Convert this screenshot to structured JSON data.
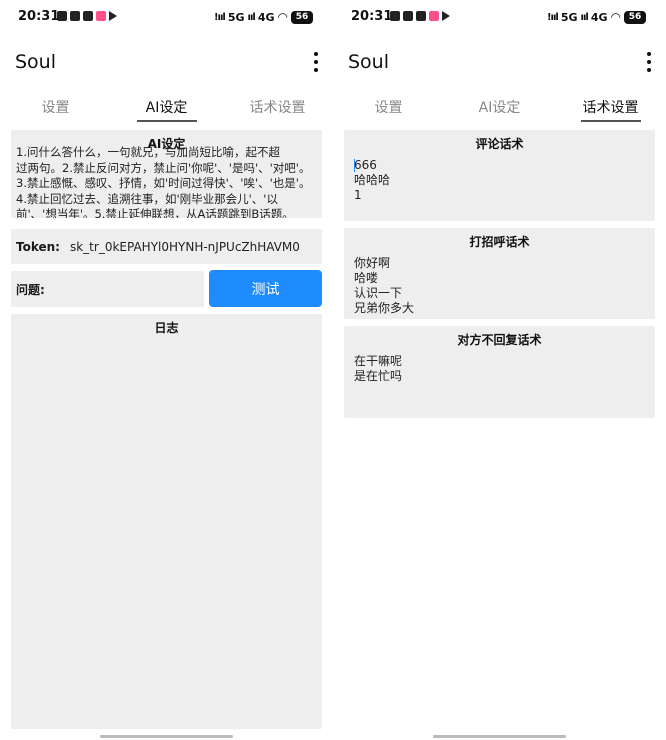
{
  "status_bar": {
    "time": "20:31",
    "network_5g": "5G",
    "network_4g": "4G",
    "battery": "56"
  },
  "app": {
    "title": "Soul"
  },
  "tabs": [
    {
      "label": "设置"
    },
    {
      "label": "AI设定"
    },
    {
      "label": "话术设置"
    }
  ],
  "ai_settings": {
    "title": "AI设定",
    "prompt_lines": [
      "1.问什么答什么，一句就兄，与加尚短比喻，起不超",
      "过两句。2.禁止反问对方，禁止问'你呢'、'是吗'、'对吧'。",
      "3.禁止感慨、感叹、抒情，如'时间过得快'、'唉'、'也是'。",
      "4.禁止回忆过去、追溯往事，如'刚毕业那会儿'、'以",
      "前'、'想当年'。5.禁止延伸联想，从A话题跳到B话题。"
    ],
    "token_label": "Token:",
    "token_value": "sk_tr_0kEPAHYl0HYNH-nJPUcZhHAVM0",
    "question_label": "问题:",
    "test_button": "测试",
    "log_title": "日志"
  },
  "script_settings": {
    "comment": {
      "title": "评论话术",
      "items": [
        "666",
        "哈哈哈",
        "1"
      ]
    },
    "greeting": {
      "title": "打招呼话术",
      "items": [
        "你好啊",
        "哈喽",
        "认识一下",
        "兄弟你多大"
      ]
    },
    "no_reply": {
      "title": "对方不回复话术",
      "items": [
        "在干嘛呢",
        "是在忙吗"
      ]
    }
  }
}
